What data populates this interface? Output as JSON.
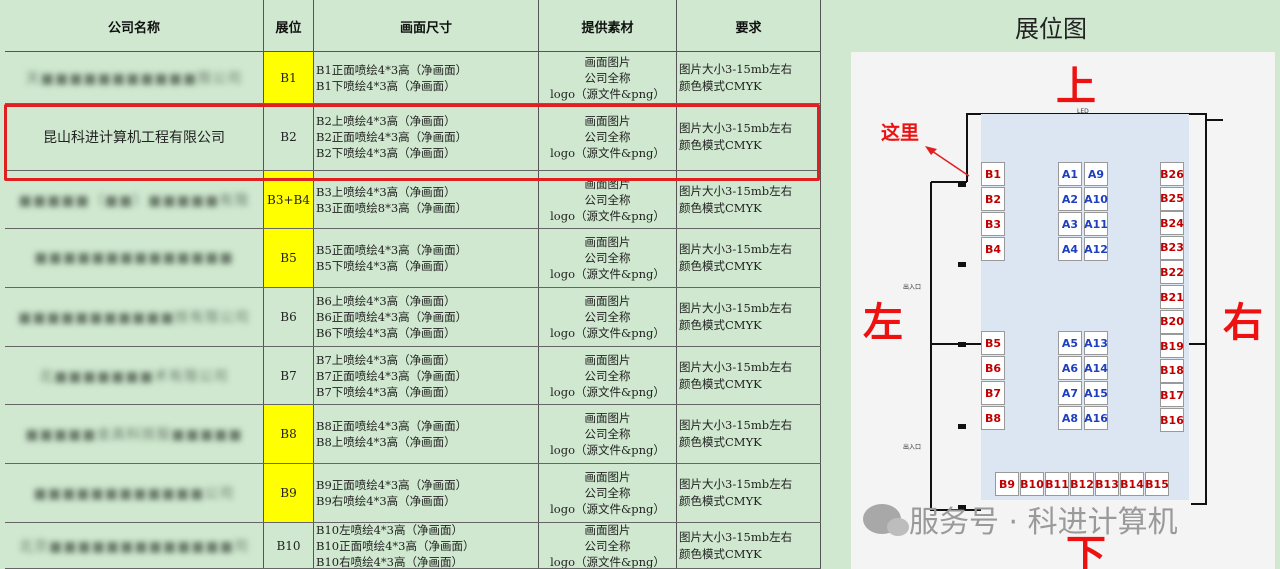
{
  "headers": {
    "company": "公司名称",
    "position": "展位",
    "size": "画面尺寸",
    "materials": "提供素材",
    "requirements": "要求"
  },
  "rows": [
    {
      "company": "天■■■■■■■■■■■限公司",
      "position": "B1",
      "yellow": true,
      "sizes": [
        "B1正面喷绘4*3高（净画面）",
        "B1下喷绘4*3高（净画面）"
      ],
      "materials": [
        "画面图片",
        "公司全称",
        "logo（源文件&png）"
      ],
      "reqs": [
        "图片大小3-15mb左右",
        "颜色模式CMYK"
      ]
    },
    {
      "company": "昆山科进计算机工程有限公司",
      "position": "B2",
      "yellow": false,
      "sizes": [
        "B2上喷绘4*3高（净画面）",
        "B2正面喷绘4*3高（净画面）",
        "B2下喷绘4*3高（净画面）"
      ],
      "materials": [
        "画面图片",
        "公司全称",
        "logo（源文件&png）"
      ],
      "reqs": [
        "图片大小3-15mb左右",
        "颜色模式CMYK"
      ]
    },
    {
      "company": "■■■■■（■■）■■■■■有限",
      "position": "B3+B4",
      "yellow": true,
      "sizes": [
        "B3上喷绘4*3高（净画面）",
        "B3正面喷绘8*3高（净画面）"
      ],
      "materials": [
        "画面图片",
        "公司全称",
        "logo（源文件&png）"
      ],
      "reqs": [
        "图片大小3-15mb左右",
        "颜色模式CMYK"
      ]
    },
    {
      "company": "■■■■■■■■■■■■■■",
      "position": "B5",
      "yellow": true,
      "sizes": [
        "B5正面喷绘4*3高（净画面）",
        "B5下喷绘4*3高（净画面）"
      ],
      "materials": [
        "画面图片",
        "公司全称",
        "logo（源文件&png）"
      ],
      "reqs": [
        "图片大小3-15mb左右",
        "颜色模式CMYK"
      ]
    },
    {
      "company": "■■■■■■■■■■■技有限公司",
      "position": "B6",
      "yellow": false,
      "sizes": [
        "B6上喷绘4*3高（净画面）",
        "B6正面喷绘4*3高（净画面）",
        "B6下喷绘4*3高（净画面）"
      ],
      "materials": [
        "画面图片",
        "公司全称",
        "logo（源文件&png）"
      ],
      "reqs": [
        "图片大小3-15mb左右",
        "颜色模式CMYK"
      ]
    },
    {
      "company": "北■■■■■■■术有限公司",
      "position": "B7",
      "yellow": false,
      "sizes": [
        "B7上喷绘4*3高（净画面）",
        "B7正面喷绘4*3高（净画面）",
        "B7下喷绘4*3高（净画面）"
      ],
      "materials": [
        "画面图片",
        "公司全称",
        "logo（源文件&png）"
      ],
      "reqs": [
        "图片大小3-15mb左右",
        "颜色模式CMYK"
      ]
    },
    {
      "company": "■■■■■金高科技股■■■■■",
      "position": "B8",
      "yellow": true,
      "sizes": [
        "B8正面喷绘4*3高（净画面）",
        "B8上喷绘4*3高（净画面）"
      ],
      "materials": [
        "画面图片",
        "公司全称",
        "logo（源文件&png）"
      ],
      "reqs": [
        "图片大小3-15mb左右",
        "颜色模式CMYK"
      ]
    },
    {
      "company": "■■■■■■■■■■■■公司",
      "position": "B9",
      "yellow": true,
      "sizes": [
        "B9正面喷绘4*3高（净画面）",
        "B9右喷绘4*3高（净画面）"
      ],
      "materials": [
        "画面图片",
        "公司全称",
        "logo（源文件&png）"
      ],
      "reqs": [
        "图片大小3-15mb左右",
        "颜色模式CMYK"
      ]
    },
    {
      "company": "北京■■■■■■■■■■■■■司",
      "position": "B10",
      "yellow": false,
      "sizes": [
        "B10左喷绘4*3高（净画面）",
        "B10正面喷绘4*3高（净画面）",
        "B10右喷绘4*3高（净画面）"
      ],
      "materials": [
        "画面图片",
        "公司全称",
        "logo（源文件&png）"
      ],
      "reqs": [
        "图片大小3-15mb左右",
        "颜色模式CMYK"
      ]
    }
  ],
  "map": {
    "title": "展位图",
    "top": "上",
    "bottom": "下",
    "left": "左",
    "right": "右",
    "here": "这里",
    "led": "LED",
    "entrance": "出入口",
    "left_col_top": [
      "B1",
      "B2",
      "B3",
      "B4"
    ],
    "left_col_bottom": [
      "B5",
      "B6",
      "B7",
      "B8"
    ],
    "center_left_top": [
      "A1",
      "A2",
      "A3",
      "A4"
    ],
    "center_right_top": [
      "A9",
      "A10",
      "A11",
      "A12"
    ],
    "center_left_bottom": [
      "A5",
      "A6",
      "A7",
      "A8"
    ],
    "center_right_bottom": [
      "A13",
      "A14",
      "A15",
      "A16"
    ],
    "right_col": [
      "B26",
      "B25",
      "B24",
      "B23",
      "B22",
      "B21",
      "B20",
      "B19",
      "B18",
      "B17",
      "B16"
    ],
    "bottom_row": [
      "B9",
      "B10",
      "B11",
      "B12",
      "B13",
      "B14",
      "B15"
    ]
  },
  "watermark": "服务号 · 科进计算机"
}
